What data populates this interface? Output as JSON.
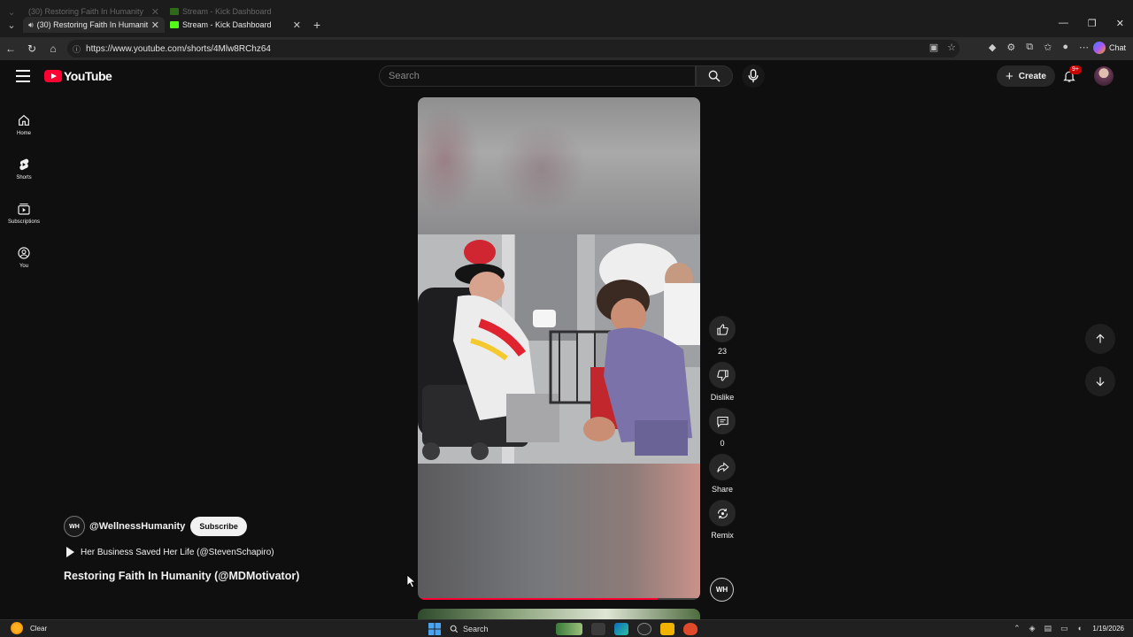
{
  "browser": {
    "tabs": [
      {
        "title": "(30) Restoring Faith In Humanity",
        "favicon": "youtube-icon",
        "audio": true
      },
      {
        "title": "Stream - Kick Dashboard",
        "favicon": "kick-icon",
        "audio": false
      }
    ],
    "url": "https://www.youtube.com/shorts/4Mlw8RChz64",
    "chat_label": "Chat"
  },
  "youtube": {
    "logo_text": "YouTube",
    "search_placeholder": "Search",
    "create_label": "Create",
    "notification_badge": "9+",
    "sidebar": [
      {
        "label": "Home",
        "icon": "home-icon"
      },
      {
        "label": "Shorts",
        "icon": "shorts-icon"
      },
      {
        "label": "Subscriptions",
        "icon": "subscriptions-icon"
      },
      {
        "label": "You",
        "icon": "you-icon"
      }
    ],
    "actions": {
      "like_count": "23",
      "dislike_label": "Dislike",
      "comment_count": "0",
      "share_label": "Share",
      "remix_label": "Remix"
    },
    "short": {
      "channel_initials": "WH",
      "channel_handle": "@WellnessHumanity",
      "subscribe_label": "Subscribe",
      "playlist_label": "Her Business Saved Her Life (@StevenSchapiro)",
      "title": "Restoring Faith In Humanity (@MDMotivator)",
      "progress": 0.85
    }
  },
  "taskbar": {
    "weather_text": "Clear",
    "search_label": "Search",
    "date": "1/19/2026"
  },
  "colors": {
    "brand_red": "#ff0033",
    "background": "#0f0f0f"
  }
}
